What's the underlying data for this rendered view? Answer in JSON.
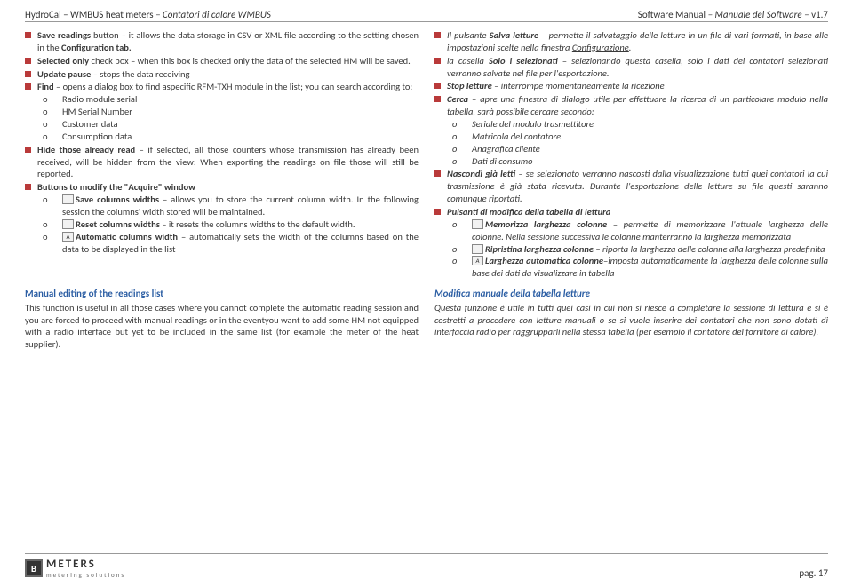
{
  "header": {
    "left_en": "HydroCal – WMBUS heat meters",
    "left_it": " – Contatori di calore WMBUS",
    "right_en": "Software Manual",
    "right_it": " – Manuale del Software – ",
    "version": "v1.7"
  },
  "left_col": {
    "i1a": "Save readings",
    "i1b": " button – it allows the data storage in CSV or XML file according to the setting chosen in the ",
    "i1c": "Configuration tab.",
    "i2a": "Selected only",
    "i2b": " check box – when this box is checked only the data of the selected HM will be saved.",
    "i3a": "Update pause",
    "i3b": " – stops the data receiving",
    "i4a": "Find",
    "i4b": " – opens a dialog box to find aspecific RFM-TXH module in the list; you can search according to:",
    "i4_o1": "Radio module serial",
    "i4_o2": "HM Serial Number",
    "i4_o3": "Customer data",
    "i4_o4": "Consumption data",
    "i5a": "Hide those already read",
    "i5b": " – if selected, all those counters whose transmission has already been received, will be hidden from the view: When exporting the readings on file those will still be reported.",
    "i6a": "Buttons to modify the \"Acquire\" window",
    "i6_o1a": "Save columns widths",
    "i6_o1b": " – allows you to store the current column width. In the following session the columns' width stored will be maintained.",
    "i6_o2a": "Reset columns widths",
    "i6_o2b": " – it resets the columns widths to the default width.",
    "i6_o3a": "Automatic columns width",
    "i6_o3b": "  – automatically sets the width of the columns based on the data to be displayed in the list"
  },
  "right_col": {
    "i1a": "Il pulsante ",
    "i1b": "Salva letture",
    "i1c": " – permette il salvataggio delle letture in un file di vari formati, in base alle impostazioni scelte nella finestra ",
    "i1d": "Configurazione",
    "i1e": ".",
    "i2a": "la casella ",
    "i2b": "Solo i selezionati",
    "i2c": " – selezionando questa casella, solo i dati dei contatori selezionati verranno salvate nel file per l'esportazione.",
    "i3a": "Stop letture",
    "i3b": " – interrompe momentaneamente la ricezione",
    "i4a": "Cerca",
    "i4b": " – apre una finestra di dialogo utile per effettuare la ricerca di un particolare modulo nella tabella, sarà possibile cercare secondo:",
    "i4_o1": "Seriale del modulo trasmettitore",
    "i4_o2": "Matricola del contatore",
    "i4_o3": "Anagrafica cliente",
    "i4_o4": "Dati di consumo",
    "i5a": "Nascondi già letti",
    "i5b": " – se selezionato verranno nascosti dalla visualizzazione tutti quei contatori la cui trasmissione è già stata ricevuta. Durante l'esportazione delle letture su file questi saranno comunque riportati.",
    "i6a": "Pulsanti di modifica della tabella di lettura",
    "i6_o1a": "Memorizza larghezza colonne",
    "i6_o1b": " – permette di memorizzare l'attuale larghezza delle colonne. Nella sessione successiva le colonne manterranno la larghezza memorizzata",
    "i6_o2a": "Ripristina larghezza colonne",
    "i6_o2b": " – riporta la larghezza delle colonne alla larghezza predefinita",
    "i6_o3a": "Larghezza automatica colonne",
    "i6_o3b": "–imposta automaticamente la larghezza delle colonne sulla base dei dati da visualizzare in tabella"
  },
  "section": {
    "left_hdr": "Manual editing of the readings list",
    "left_body": "This function is useful in all those cases where you cannot complete the automatic reading session and you are forced to proceed with manual readings or in the eventyou want to add some HM not equipped with a radio interface but yet to be included in the same list (for example the meter of the heat supplier).",
    "right_hdr": "Modifica manuale della tabella letture",
    "right_body": "Questa funzione è utile in tutti quei casi in cui non si riesce a completare la sessione di lettura e si è costretti a procedere con letture manuali o se si vuole inserire dei contatori che non sono dotati di interfaccia radio per raggrupparli nella stessa tabella (per esempio il contatore del fornitore di calore)."
  },
  "footer": {
    "brand1": "B",
    "brand2": "METERS",
    "brand_sub": "metering solutions",
    "page": "pag. 17"
  }
}
